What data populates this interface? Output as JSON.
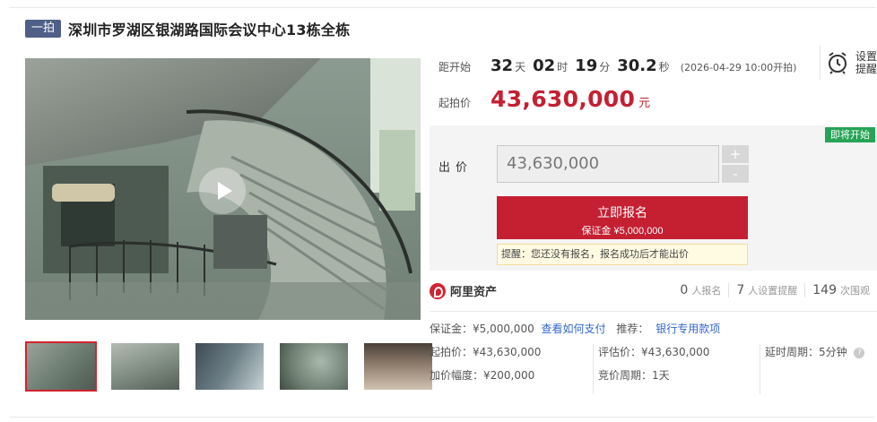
{
  "header": {
    "tag": "一拍",
    "title": "深圳市罗湖区银湖路国际会议中心13栋全栋"
  },
  "countdown": {
    "label": "距开始",
    "days": "32",
    "days_unit": "天",
    "hours": "02",
    "hours_unit": "时",
    "minutes": "19",
    "minutes_unit": "分",
    "seconds": "30.2",
    "seconds_unit": "秒",
    "start_time": "(2026-04-29 10:00开拍)"
  },
  "remind": {
    "icon": "alarm-clock-icon",
    "label": "设置提醒"
  },
  "start_price": {
    "label": "起拍价",
    "value": "43,630,000",
    "unit": "元"
  },
  "bid": {
    "badge": "即将开始",
    "label": "出价",
    "value": "43,630,000",
    "plus": "+",
    "minus": "-",
    "apply_label": "立即报名",
    "deposit_label": "保证金 ¥5,000,000",
    "notice": "提醒：您还没有报名，报名成功后才能出价"
  },
  "platform": {
    "name": "阿里资产",
    "stats": [
      {
        "num": "0",
        "label": "人报名"
      },
      {
        "num": "7",
        "label": "人设置提醒"
      },
      {
        "num": "149",
        "label": "次围观"
      }
    ]
  },
  "info": {
    "deposit": "保证金：¥5,000,000",
    "how_pay": "查看如何支付",
    "recommend_label": "推荐：",
    "recommend_link": "银行专用款项",
    "start_price": "起拍价：¥43,630,000",
    "increment": "加价幅度：¥200,000",
    "appraisal": "评估价：¥43,630,000",
    "cycle": "竞价周期：1天",
    "delay": "延时周期：5分钟"
  },
  "colors": {
    "accent": "#c51f32",
    "tag_bg": "#4f5f87",
    "badge": "#26a356",
    "link": "#3366cc"
  }
}
